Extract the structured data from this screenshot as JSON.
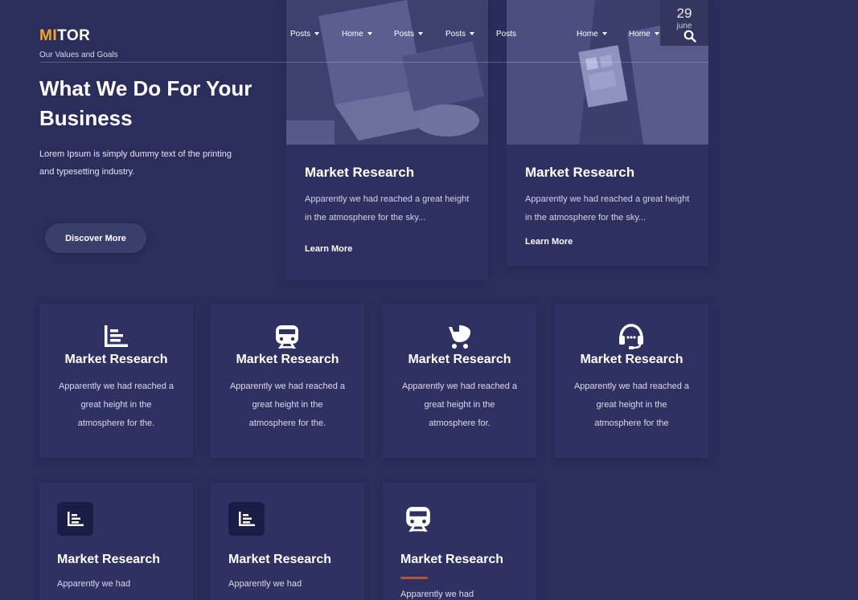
{
  "brand": {
    "logo_prefix": "MI",
    "logo_suffix": "TOR",
    "tagline": "Our Values and Goals"
  },
  "nav": {
    "items": [
      {
        "label": "Posts",
        "dropdown": true
      },
      {
        "label": "Home",
        "dropdown": true
      },
      {
        "label": "Posts",
        "dropdown": true
      },
      {
        "label": "Posts",
        "dropdown": true
      },
      {
        "label": "Posts",
        "dropdown": false
      },
      {
        "label": "Home",
        "dropdown": true
      },
      {
        "label": "Home",
        "dropdown": true
      }
    ],
    "search_icon": "search-icon"
  },
  "date_badge": {
    "day": "29",
    "month": "june"
  },
  "intro": {
    "title": "What We Do For Your Business",
    "text": "Lorem Ipsum is simply dummy text of the printing and typesetting industry.",
    "button_label": "Discover More"
  },
  "blog_cards": [
    {
      "title": "Market Research",
      "text": "Apparently we had reached a great height in the atmosphere for the sky...",
      "link_label": "Learn More"
    },
    {
      "title": "Market Research",
      "text": "Apparently we had reached a great height in the atmosphere for the sky...",
      "link_label": "Learn More"
    }
  ],
  "services_row1": [
    {
      "icon": "bar-chart-icon",
      "title": "Market Research",
      "text": "Apparently we had reached a great height in the atmosphere for the."
    },
    {
      "icon": "train-icon",
      "title": "Market Research",
      "text": "Apparently we had reached a great height in the atmosphere for the."
    },
    {
      "icon": "stroller-icon",
      "title": "Market Research",
      "text": "Apparently we had reached a great height in the atmosphere for."
    },
    {
      "icon": "headset-icon",
      "title": "Market Research",
      "text": "Apparently we had reached a great height in the atmosphere for the"
    }
  ],
  "services_row2": [
    {
      "icon": "bar-chart-icon",
      "title": "Market Research",
      "text": "Apparently we had"
    },
    {
      "icon": "bar-chart-icon",
      "title": "Market Research",
      "text": "Apparently we had"
    },
    {
      "icon": "train-icon",
      "title": "Market Research",
      "text": "Apparently we had"
    }
  ],
  "colors": {
    "background": "#2b2e5c",
    "logo_accent": "#f5a623",
    "underline_accent": "#b5562e"
  }
}
